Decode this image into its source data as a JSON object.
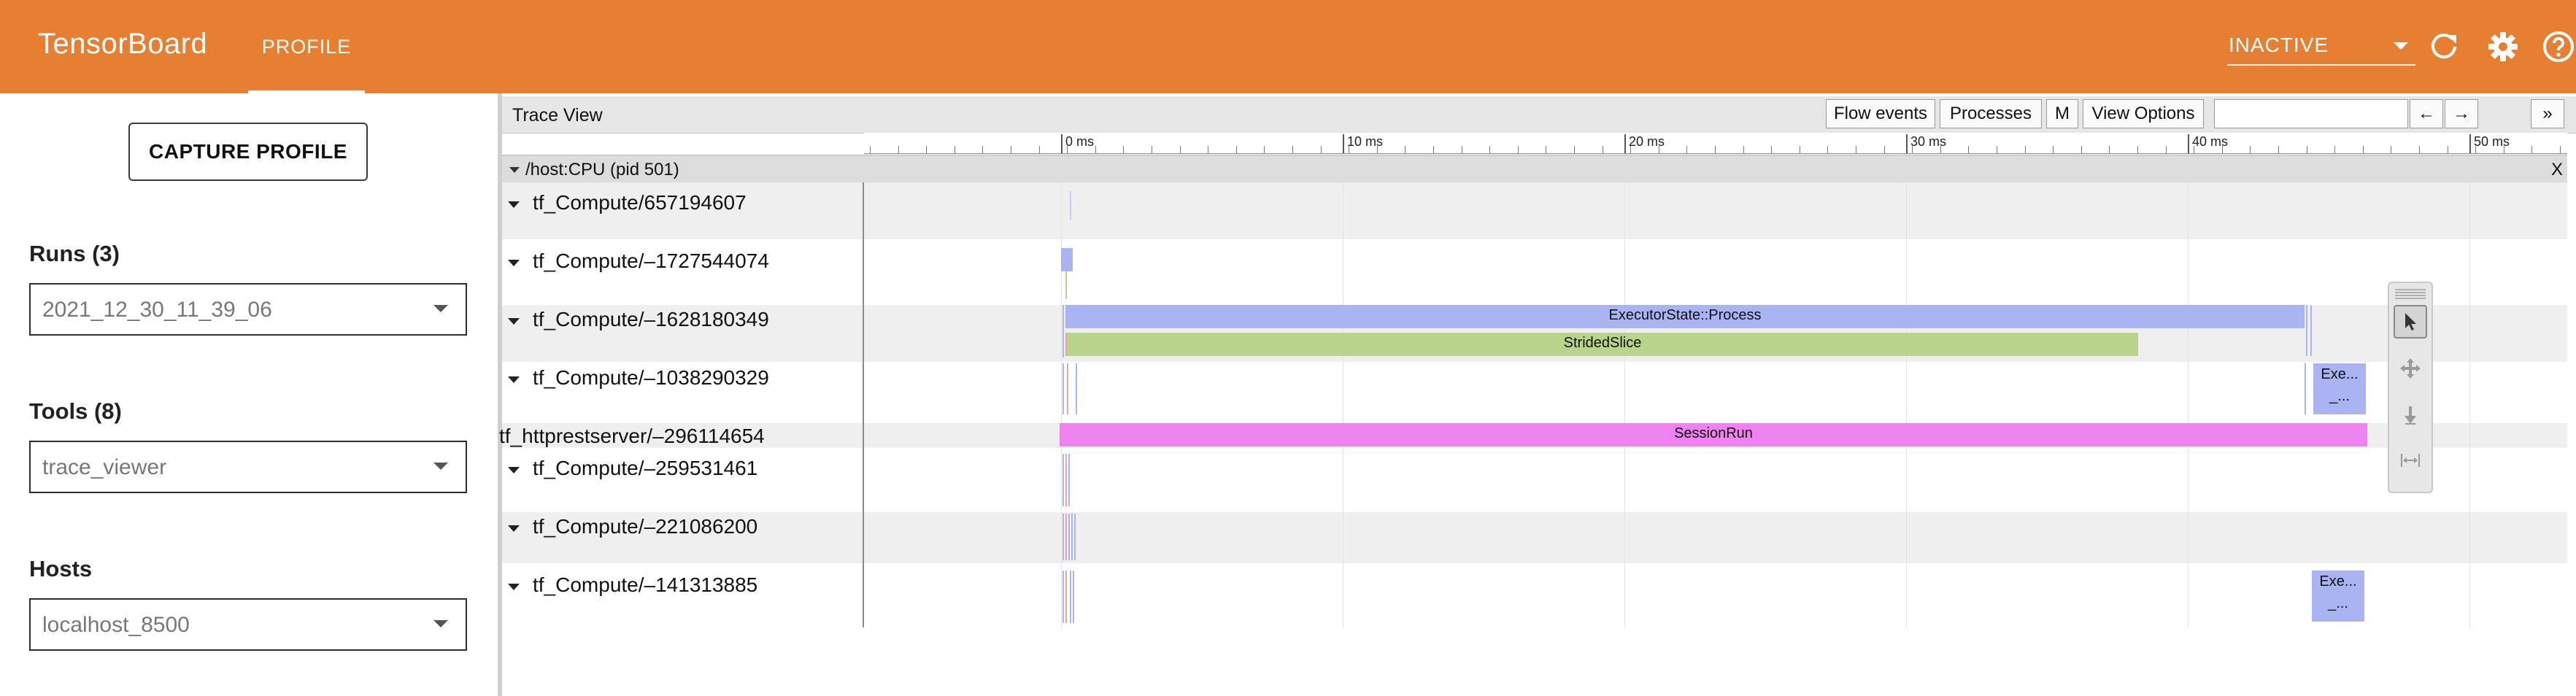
{
  "app": {
    "title": "TensorBoard",
    "active_tab": "PROFILE",
    "status": "INACTIVE",
    "accent_color": "#e67f32"
  },
  "toolbar_icons": [
    "refresh-icon",
    "settings-icon",
    "help-icon"
  ],
  "sidebar": {
    "capture_label": "CAPTURE PROFILE",
    "runs_label": "Runs (3)",
    "runs_value": "2021_12_30_11_39_06",
    "tools_label": "Tools (8)",
    "tools_value": "trace_viewer",
    "hosts_label": "Hosts",
    "hosts_value": "localhost_8500"
  },
  "trace_view": {
    "title": "Trace View",
    "buttons": {
      "flow_events": "Flow events",
      "processes": "Processes",
      "metadata": "M",
      "view_options": "View Options",
      "prev": "←",
      "next": "→",
      "more": "»"
    },
    "ruler_labels": [
      "0 ms",
      "10 ms",
      "20 ms",
      "30 ms",
      "40 ms",
      "50 ms"
    ],
    "process_name": "/host:CPU (pid 501)",
    "process_close": "X",
    "tracks": [
      {
        "name": "tf_Compute/657194607",
        "collapsible": true
      },
      {
        "name": "tf_Compute/–1727544074",
        "collapsible": true
      },
      {
        "name": "tf_Compute/–1628180349",
        "collapsible": true
      },
      {
        "name": "tf_Compute/–1038290329",
        "collapsible": true
      },
      {
        "name": "tf_httprestserver/–296114654",
        "collapsible": false
      },
      {
        "name": "tf_Compute/–259531461",
        "collapsible": true
      },
      {
        "name": "tf_Compute/–221086200",
        "collapsible": true
      },
      {
        "name": "tf_Compute/–141313885",
        "collapsible": true
      }
    ],
    "slices": {
      "executor_process": "ExecutorState::Process",
      "strided_slice": "StridedSlice",
      "session_run": "SessionRun",
      "exe_a_line1": "Exe...",
      "exe_a_line2": "_...",
      "exe_b_line1": "Exe...",
      "exe_b_line2": "_..."
    },
    "colors": {
      "executor": "#aab4f2",
      "strided": "#b8d38a",
      "session": "#ee82ee"
    }
  }
}
